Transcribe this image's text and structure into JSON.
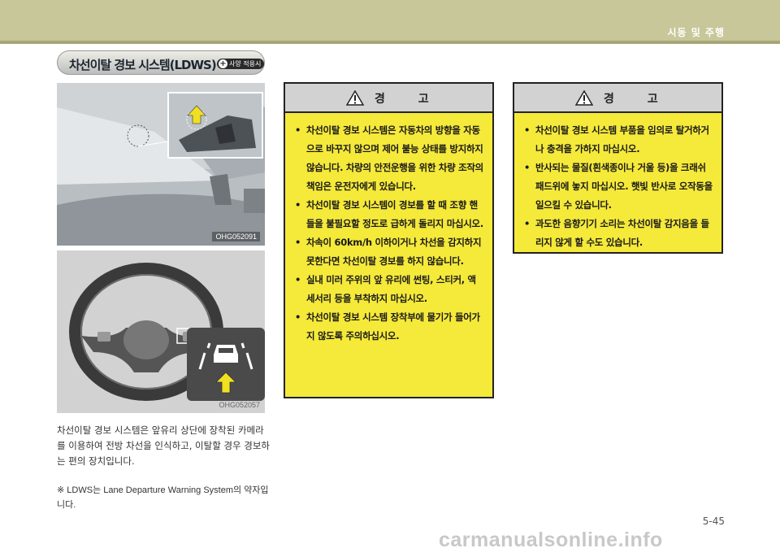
{
  "header": {
    "chapter_title": "시동 및 주행"
  },
  "section": {
    "title": "차선이탈 경보 시스템(LDWS)",
    "badge": "사양 적용시"
  },
  "figures": [
    {
      "code": "OHG052091",
      "icon": "windshield-camera-illustration"
    },
    {
      "code": "OHG052057",
      "icon": "steering-wheel-lane-indicator-illustration"
    }
  ],
  "body_text": "차선이탈 경보 시스템은 앞유리 상단에 장착된 카메라를 이용하여 전방 차선을 인식하고, 이탈할 경우 경보하는 편의 장치입니다.",
  "note_text": "※ LDWS는 Lane Departure Warning System의 약자입니다.",
  "warnings": [
    {
      "title": "경 고",
      "items": [
        "차선이탈 경보 시스템은 자동차의 방향을 자동으로 바꾸지 않으며 제어 불능 상태를 방지하지 않습니다. 차량의 안전운행을 위한 차량 조작의 책임은 운전자에게 있습니다.",
        "차선이탈 경보 시스템이 경보를 할 때 조향 핸들을 불필요할 정도로 급하게 돌리지 마십시오.",
        "차속이 60km/h 이하이거나 차선을 감지하지 못한다면 차선이탈 경보를 하지 않습니다.",
        "실내 미러 주위의 앞 유리에 썬팅, 스티커, 액세서리 등을 부착하지 마십시오.",
        "차선이탈 경보 시스템 장착부에 물기가 들어가지 않도록 주의하십시오."
      ]
    },
    {
      "title": "경 고",
      "items": [
        "차선이탈 경보 시스템 부품을 임의로 탈거하거나 충격을 가하지 마십시오.",
        "반사되는 물질(흰색종이나 거울 등)을 크래쉬패드위에 놓지 마십시오. 햇빛 반사로 오작동을 일으킬 수 있습니다.",
        "과도한 음향기기 소리는 차선이탈 감지음을 들리지 않게 할 수도 있습니다."
      ]
    }
  ],
  "page_number": "5-45",
  "watermark": "carmanualsonline.info",
  "colors": {
    "header_band": "#c7c79a",
    "warning_box": "#f5e93a",
    "warning_header": "#d2d2d2",
    "arrow_highlight": "#f0e020"
  }
}
